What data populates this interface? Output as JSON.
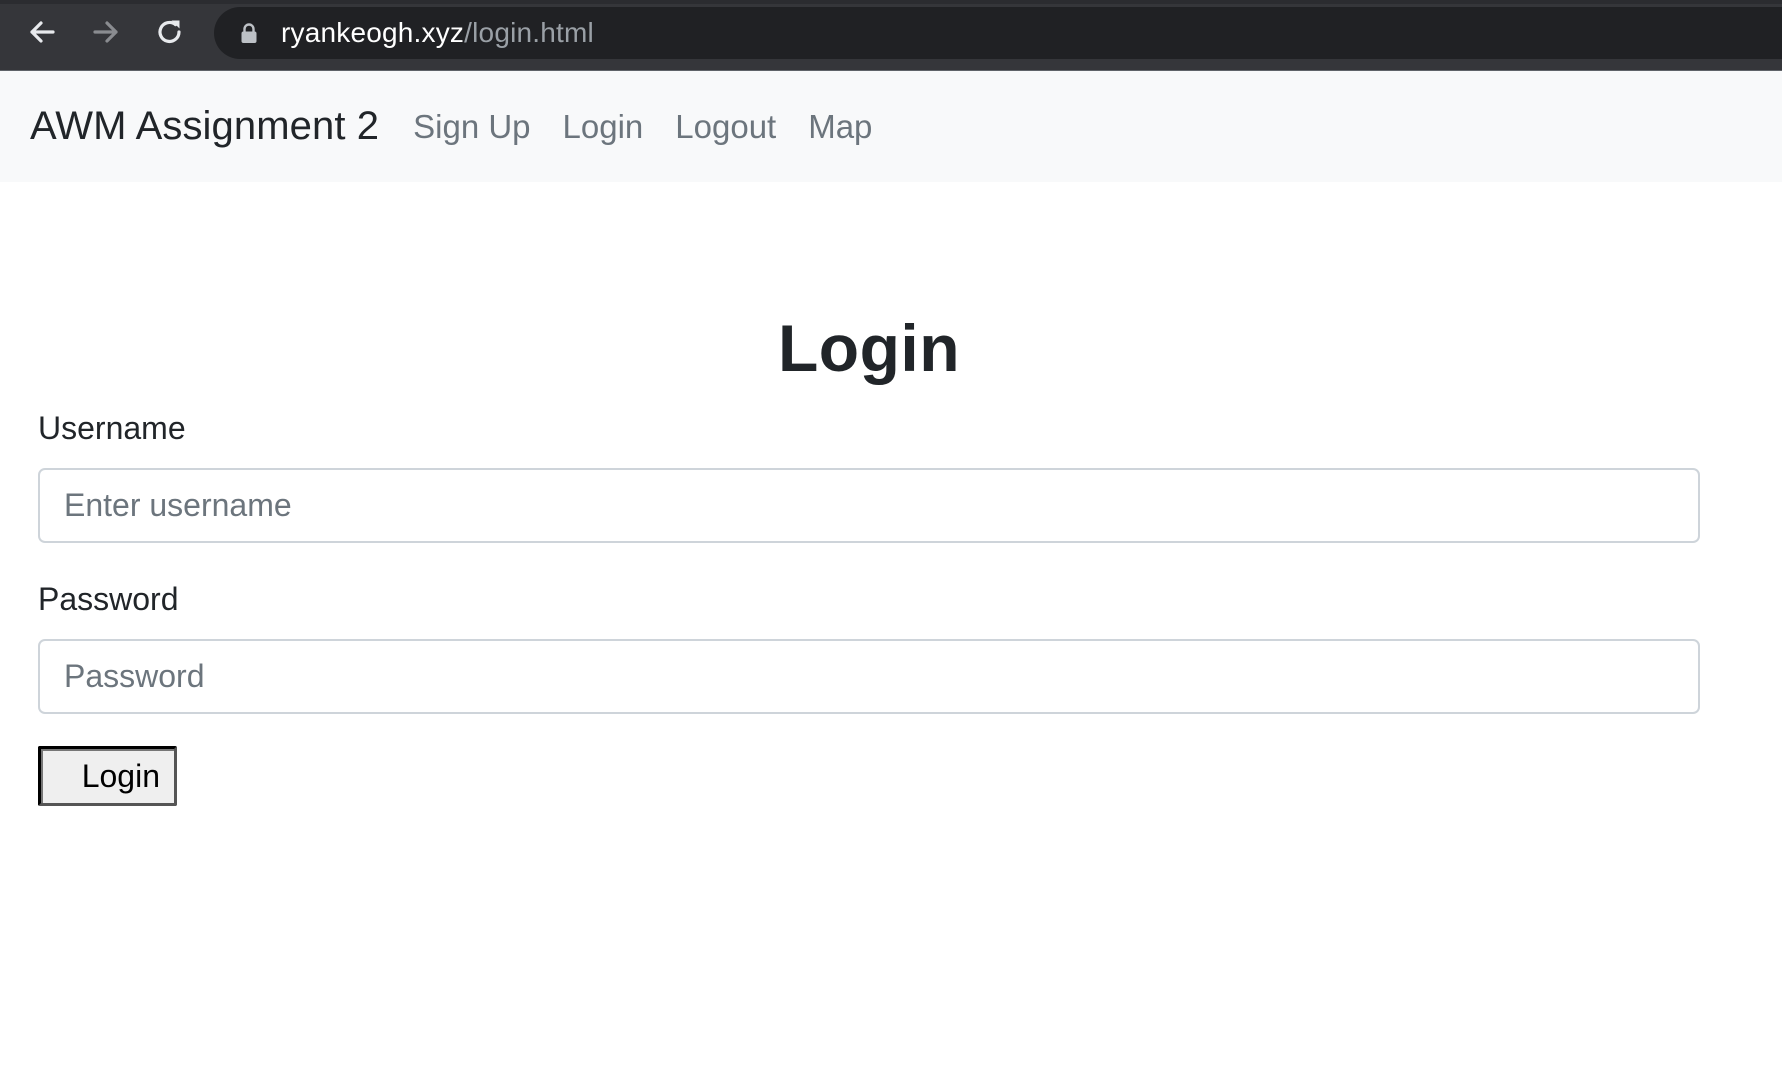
{
  "browser": {
    "url_host": "ryankeogh.xyz",
    "url_path": "/login.html",
    "icons": {
      "back": "arrow-left-icon",
      "forward": "arrow-right-icon",
      "reload": "reload-icon",
      "lock": "lock-icon"
    }
  },
  "navbar": {
    "brand": "AWM Assignment 2",
    "links": [
      {
        "label": "Sign Up"
      },
      {
        "label": "Login"
      },
      {
        "label": "Logout"
      },
      {
        "label": "Map"
      }
    ]
  },
  "login_form": {
    "title": "Login",
    "username": {
      "label": "Username",
      "value": "",
      "placeholder": "Enter username"
    },
    "password": {
      "label": "Password",
      "value": "",
      "placeholder": "Password"
    },
    "submit_label": "Login"
  },
  "colors": {
    "browser_chrome": "#35363a",
    "omnibox": "#202124",
    "navbar_bg": "#f8f9fa",
    "nav_link": "#6c757d",
    "text": "#212529",
    "input_border": "#ced4da"
  }
}
